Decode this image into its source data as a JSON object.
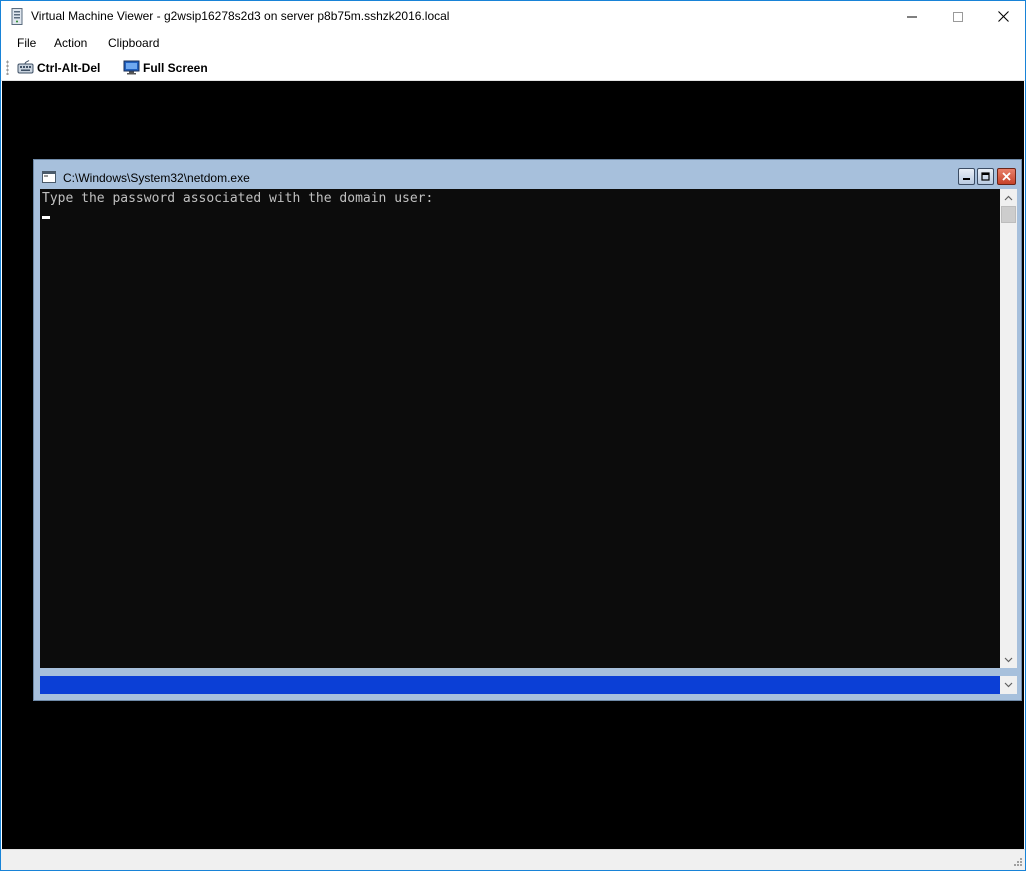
{
  "window": {
    "title": "Virtual Machine Viewer - g2wsip16278s2d3 on server p8b75m.sshzk2016.local",
    "controls": {
      "minimize": "minimize-icon",
      "maximize": "maximize-icon",
      "close": "close-icon"
    }
  },
  "menu": {
    "items": [
      {
        "label": "File"
      },
      {
        "label": "Action"
      },
      {
        "label": "Clipboard"
      }
    ]
  },
  "toolbar": {
    "ctrl_alt_del_label": "Ctrl-Alt-Del",
    "ctrl_alt_del_icon": "keyboard-icon",
    "full_screen_label": "Full Screen",
    "full_screen_icon": "monitor-icon"
  },
  "console": {
    "title": "C:\\Windows\\System32\\netdom.exe",
    "lines": [
      "Type the password associated with the domain user:"
    ]
  },
  "colors": {
    "accent_border": "#1883d7",
    "vm_background": "#000000",
    "console_frame": "#a7c0dc",
    "console_background": "#0c0c0c",
    "console_text": "#c0c0c0",
    "bottom_bar": "#0b3fd6",
    "close_button": "#c7432a"
  }
}
